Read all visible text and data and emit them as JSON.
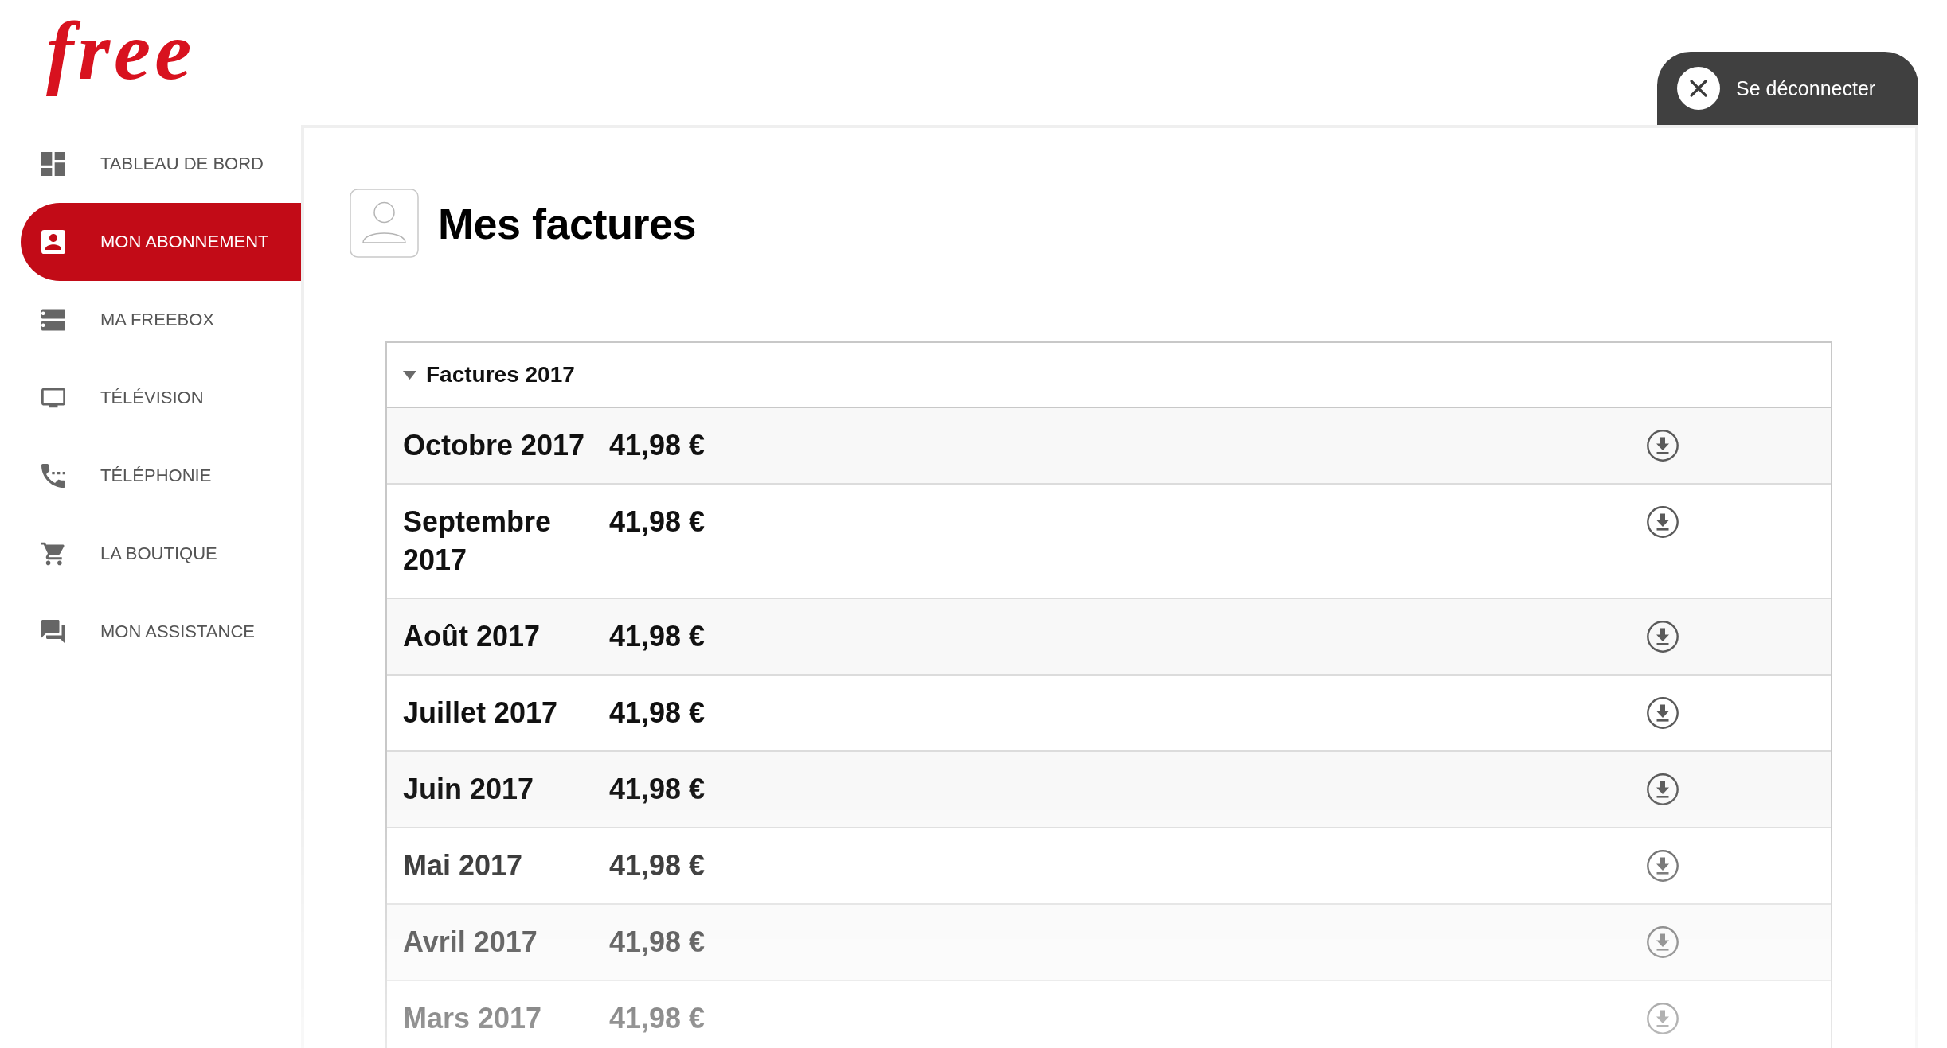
{
  "logo": "free",
  "logout_button": {
    "label": "Se déconnecter"
  },
  "sidebar": {
    "items": [
      {
        "label": "TABLEAU DE BORD",
        "selected": false
      },
      {
        "label": "MON ABONNEMENT",
        "selected": true
      },
      {
        "label": "MA FREEBOX",
        "selected": false
      },
      {
        "label": "TÉLÉVISION",
        "selected": false
      },
      {
        "label": "TÉLÉPHONIE",
        "selected": false
      },
      {
        "label": "LA BOUTIQUE",
        "selected": false
      },
      {
        "label": "MON ASSISTANCE",
        "selected": false
      }
    ]
  },
  "page_title": "Mes factures",
  "invoices": {
    "title": "Factures 2017",
    "expanded": true,
    "rows": [
      {
        "month": "Octobre 2017",
        "amount": "41,98 €"
      },
      {
        "month": "Septembre 2017",
        "amount": "41,98 €"
      },
      {
        "month": "Août 2017",
        "amount": "41,98 €"
      },
      {
        "month": "Juillet 2017",
        "amount": "41,98 €"
      },
      {
        "month": "Juin 2017",
        "amount": "41,98 €"
      },
      {
        "month": "Mai 2017",
        "amount": "41,98 €"
      },
      {
        "month": "Avril 2017",
        "amount": "41,98 €"
      },
      {
        "month": "Mars 2017",
        "amount": "41,98 €"
      }
    ]
  }
}
